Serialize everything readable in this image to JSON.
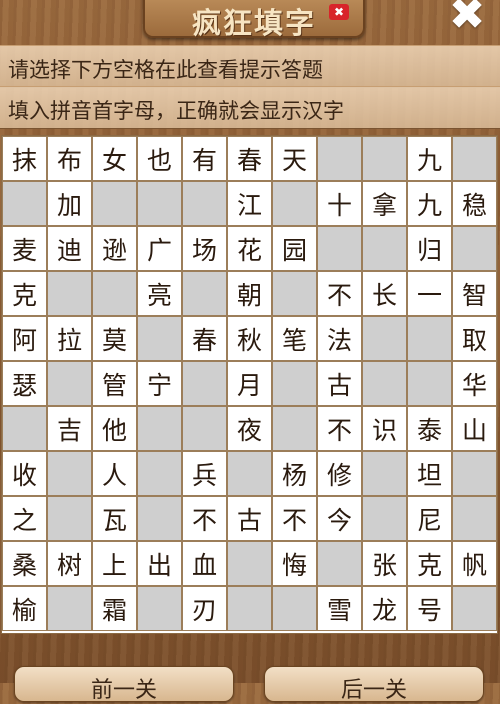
{
  "header": {
    "title": "疯狂填字",
    "badge": "✖",
    "close_label": "✖"
  },
  "hints": {
    "line1": "请选择下方空格在此查看提示答题",
    "line2": "填入拼音首字母，正确就会显示汉字"
  },
  "grid": [
    [
      "抹",
      "布",
      "女",
      "也",
      "有",
      "春",
      "天",
      "",
      "",
      "九",
      ""
    ],
    [
      "",
      "加",
      "",
      "",
      "",
      "江",
      "",
      "十",
      "拿",
      "九",
      "稳"
    ],
    [
      "麦",
      "迪",
      "逊",
      "广",
      "场",
      "花",
      "园",
      "",
      "",
      "归",
      ""
    ],
    [
      "克",
      "",
      "",
      "亮",
      "",
      "朝",
      "",
      "不",
      "长",
      "一",
      "智"
    ],
    [
      "阿",
      "拉",
      "莫",
      "",
      "春",
      "秋",
      "笔",
      "法",
      "",
      "",
      "取"
    ],
    [
      "瑟",
      "",
      "管",
      "宁",
      "",
      "月",
      "",
      "古",
      "",
      "",
      "华"
    ],
    [
      "",
      "吉",
      "他",
      "",
      "",
      "夜",
      "",
      "不",
      "识",
      "泰",
      "山"
    ],
    [
      "收",
      "",
      "人",
      "",
      "兵",
      "",
      "杨",
      "修",
      "",
      "坦",
      ""
    ],
    [
      "之",
      "",
      "瓦",
      "",
      "不",
      "古",
      "不",
      "今",
      "",
      "尼",
      ""
    ],
    [
      "桑",
      "树",
      "上",
      "出",
      "血",
      "",
      "悔",
      "",
      "张",
      "克",
      "帆"
    ],
    [
      "榆",
      "",
      "霜",
      "",
      "刃",
      "",
      "",
      "雪",
      "龙",
      "号",
      ""
    ]
  ],
  "footer": {
    "prev_label": "前一关",
    "next_label": "后一关"
  }
}
